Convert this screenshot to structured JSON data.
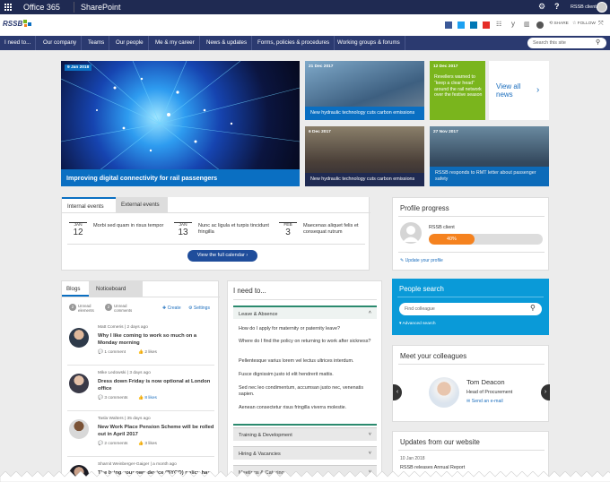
{
  "topbar": {
    "app": "Office 365",
    "site": "SharePoint",
    "user": "RSSB client"
  },
  "header": {
    "logo": "RSSB",
    "share": "SHARE",
    "follow": "FOLLOW"
  },
  "nav": {
    "items": [
      "I need to...",
      "Our company",
      "Teams",
      "Our people",
      "Me & my career",
      "News & updates",
      "Forms, policies & procedures",
      "Working groups & forums"
    ],
    "search_placeholder": "Search this site"
  },
  "news": {
    "main": {
      "date": "9 Jan 2018",
      "title": "Improving digital connectivity for rail passengers"
    },
    "t1": {
      "date": "21 Dec 2017",
      "title": "New hydraulic technology cuts carbon emissions"
    },
    "t2": {
      "date": "12 Dec 2017",
      "title": "Revellers warned to “keep a clear head” around the rail network over the festive season"
    },
    "t3": {
      "date": "6 Dec 2017",
      "title": "New hydraulic technology cuts carbon emissions"
    },
    "t4": {
      "date": "27 Nov 2017",
      "title": "RSSB responds to RMT letter about passenger safety"
    },
    "view_all": "View all news"
  },
  "events": {
    "tab_internal": "Internal events",
    "tab_external": "External events",
    "items": [
      {
        "month": "JAN",
        "day": "12",
        "text": "Morbi sed quam in risus tempor"
      },
      {
        "month": "JAN",
        "day": "13",
        "text": "Nunc ac ligula et turpis tincidunt fringilla"
      },
      {
        "month": "FEB",
        "day": "3",
        "text": "Maecenas aliquet felis et consequat rutrum"
      }
    ],
    "button": "View the full calendar"
  },
  "profile": {
    "title": "Profile progress",
    "name": "RSSB client",
    "percent": "40%",
    "pct_value": 0.4,
    "update": "Update your profile"
  },
  "blogs": {
    "tab_blogs": "Blogs",
    "tab_notice": "Noticeboard",
    "unread1_count": "2",
    "unread1": "Unread elements",
    "unread2_count": "2",
    "unread2": "Unread comments",
    "create": "Create",
    "settings": "Settings",
    "posts": [
      {
        "author": "Matt Comeris",
        "ago": "2 days ago",
        "title": "Why I like coming to work so much on a Monday morning",
        "comments": "1 comment",
        "likes": "2 likes"
      },
      {
        "author": "Mike Ledowski",
        "ago": "3 days ago",
        "title": "Dress down Friday is now optional at London office",
        "comments": "3 comments",
        "likes": "8 likes"
      },
      {
        "author": "Tasla Walters",
        "ago": "35 days ago",
        "title": "New Work Place Pension Scheme will be rolled out in April 2017",
        "comments": "2 comments",
        "likes": "3 likes"
      },
      {
        "author": "Sharnit Weinberger-Gaiger",
        "ago": "a month ago",
        "title": "The bring your own device (BYOD) policy has",
        "comments": "",
        "likes": ""
      }
    ]
  },
  "ineed": {
    "title": "I need to...",
    "section1": "Leave & Absence",
    "questions": [
      "How do I apply for maternity or paternity leave?",
      "Where do I find the policy on returning to work after sickness?",
      "Pellentesque varius lorem vel lectus ultrices interdum.",
      "Fusce dignissim justo id elit hendrerit mattis.",
      "Sed nec leo condimentum, accumsan justo nec, venenatis sapien.",
      "Aenean consectetur risus fringilla viverra molestie."
    ],
    "section2": "Training & Development",
    "section3": "Hiring & Vacancies",
    "section4": "Meetings & Catering"
  },
  "people": {
    "title": "People search",
    "placeholder": "Find colleague",
    "advanced": "Advanced search"
  },
  "colleagues": {
    "title": "Meet your colleagues",
    "name": "Tom Deacon",
    "role": "Head of Procurement",
    "email": "Send an e-mail"
  },
  "updates": {
    "title": "Updates from our website",
    "date": "10 Jan 2018",
    "headline": "RSSB releases Annual Report"
  },
  "colors": {
    "navy": "#1f2a52",
    "blue": "#0a6fc2",
    "green": "#7ab51d",
    "orange": "#f5821f"
  }
}
